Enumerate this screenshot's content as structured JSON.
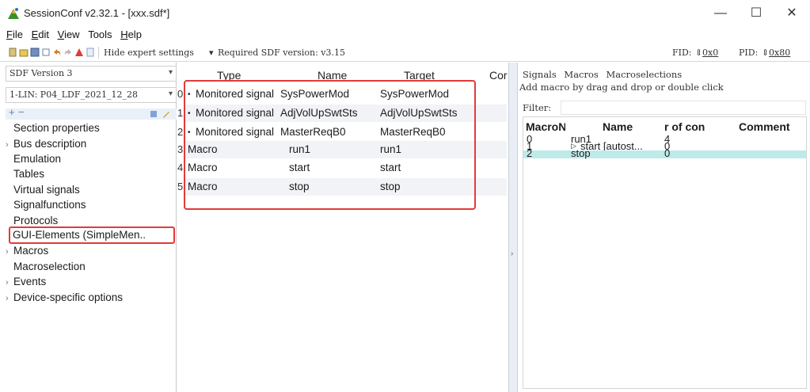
{
  "window": {
    "title": "SessionConf v2.32.1 - [xxx.sdf*]",
    "minimize": "—",
    "maximize": "☐",
    "close": "✕"
  },
  "menu": [
    {
      "label": "File",
      "ul": "F",
      "rest": "ile"
    },
    {
      "label": "Edit",
      "ul": "E",
      "rest": "dit"
    },
    {
      "label": "View",
      "ul": "V",
      "rest": "iew"
    },
    {
      "label": "Tools",
      "ul": "",
      "rest": "Tools"
    },
    {
      "label": "Help",
      "ul": "H",
      "rest": "elp"
    }
  ],
  "toolbar": {
    "hide_expert": "Hide expert settings",
    "required_sdf": "Required SDF version: v3.15",
    "fid1_label": "FID:",
    "fid1_value": "0x0",
    "fid2_label": "PID:",
    "fid2_value": "0x80"
  },
  "left": {
    "sdf_version": "SDF Version 3",
    "lin_select": "1-LIN: P04_LDF_2021_12_28",
    "plus": "+",
    "minus": "−",
    "nav": [
      {
        "label": "Section properties",
        "expandable": false
      },
      {
        "label": "Bus description",
        "expandable": true
      },
      {
        "label": "Emulation",
        "expandable": false
      },
      {
        "label": "Tables",
        "expandable": false
      },
      {
        "label": "Virtual signals",
        "expandable": false
      },
      {
        "label": "Signalfunctions",
        "expandable": false
      },
      {
        "label": "Protocols",
        "expandable": false
      },
      {
        "label": "GUI-Elements (SimpleMen..",
        "expandable": false
      },
      {
        "label": "Macros",
        "expandable": true
      },
      {
        "label": "Macroselection",
        "expandable": false
      },
      {
        "label": "Events",
        "expandable": true
      },
      {
        "label": "Device-specific options",
        "expandable": true
      }
    ]
  },
  "center": {
    "columns": {
      "type": "Type",
      "name": "Name",
      "target": "Target",
      "comment": "Cor"
    },
    "rows": [
      {
        "index": "0",
        "type": "Monitored signal",
        "name": "SysPowerMod",
        "target": "SysPowerMod"
      },
      {
        "index": "1",
        "type": "Monitored signal",
        "name": "AdjVolUpSwtSts",
        "target": "AdjVolUpSwtSts"
      },
      {
        "index": "2",
        "type": "Monitored signal",
        "name": "MasterReqB0",
        "target": "MasterReqB0"
      },
      {
        "index": "3",
        "type": "Macro",
        "name": "run1",
        "target": "run1"
      },
      {
        "index": "4",
        "type": "Macro",
        "name": "start",
        "target": "start"
      },
      {
        "index": "5",
        "type": "Macro",
        "name": "stop",
        "target": "stop"
      }
    ]
  },
  "right": {
    "tabs": [
      "Signals",
      "Macros",
      "Macroselections"
    ],
    "hint": "Add macro by drag and drop or double click",
    "filter_label": "Filter:",
    "filter_value": "",
    "columns": {
      "macro_nr": "MacroN",
      "name": "Name",
      "count": "r of con",
      "comment": "Comment"
    },
    "rows": [
      {
        "nr": "0",
        "name": "run1",
        "count": "4"
      },
      {
        "nr": "1",
        "name": "start [autost...",
        "count": "0"
      },
      {
        "nr": "2",
        "name": "stop",
        "count": "0"
      }
    ]
  },
  "colors": {
    "highlight_border": "#e23a3a",
    "selected_row": "#bfeaea"
  }
}
